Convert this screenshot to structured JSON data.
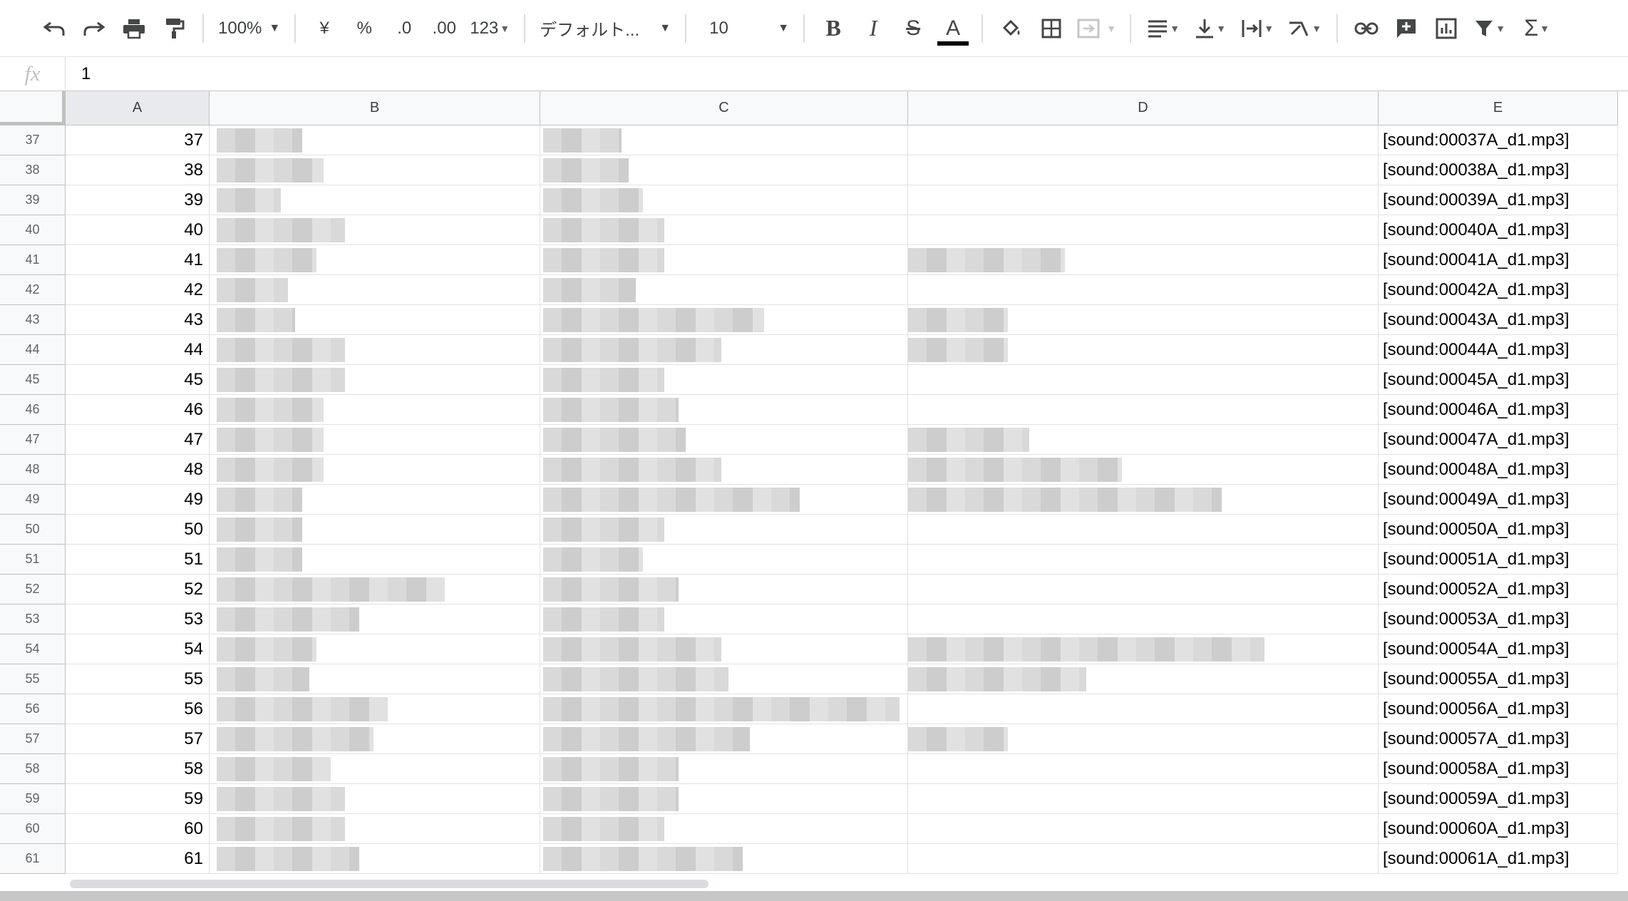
{
  "toolbar": {
    "zoom": "100%",
    "currency": "¥",
    "percent": "%",
    "decrease_decimal": ".0",
    "increase_decimal": ".00",
    "more_formats": "123",
    "font": "デフォルト...",
    "font_size": "10",
    "bold": "B",
    "italic": "I",
    "strike": "S",
    "text_color": "A"
  },
  "formula_bar": {
    "fx": "fx",
    "value": "1"
  },
  "columns": [
    {
      "letter": "A",
      "active": true
    },
    {
      "letter": "B",
      "active": false
    },
    {
      "letter": "C",
      "active": false
    },
    {
      "letter": "D",
      "active": false
    },
    {
      "letter": "E",
      "active": false
    }
  ],
  "rows": [
    {
      "row": "37",
      "a": "37",
      "e": "[sound:00037A_d1.mp3]"
    },
    {
      "row": "38",
      "a": "38",
      "e": "[sound:00038A_d1.mp3]"
    },
    {
      "row": "39",
      "a": "39",
      "e": "[sound:00039A_d1.mp3]"
    },
    {
      "row": "40",
      "a": "40",
      "e": "[sound:00040A_d1.mp3]"
    },
    {
      "row": "41",
      "a": "41",
      "e": "[sound:00041A_d1.mp3]"
    },
    {
      "row": "42",
      "a": "42",
      "e": "[sound:00042A_d1.mp3]"
    },
    {
      "row": "43",
      "a": "43",
      "e": "[sound:00043A_d1.mp3]"
    },
    {
      "row": "44",
      "a": "44",
      "e": "[sound:00044A_d1.mp3]"
    },
    {
      "row": "45",
      "a": "45",
      "e": "[sound:00045A_d1.mp3]"
    },
    {
      "row": "46",
      "a": "46",
      "e": "[sound:00046A_d1.mp3]"
    },
    {
      "row": "47",
      "a": "47",
      "e": "[sound:00047A_d1.mp3]"
    },
    {
      "row": "48",
      "a": "48",
      "e": "[sound:00048A_d1.mp3]"
    },
    {
      "row": "49",
      "a": "49",
      "e": "[sound:00049A_d1.mp3]"
    },
    {
      "row": "50",
      "a": "50",
      "e": "[sound:00050A_d1.mp3]"
    },
    {
      "row": "51",
      "a": "51",
      "e": "[sound:00051A_d1.mp3]"
    },
    {
      "row": "52",
      "a": "52",
      "e": "[sound:00052A_d1.mp3]"
    },
    {
      "row": "53",
      "a": "53",
      "e": "[sound:00053A_d1.mp3]"
    },
    {
      "row": "54",
      "a": "54",
      "e": "[sound:00054A_d1.mp3]"
    },
    {
      "row": "55",
      "a": "55",
      "e": "[sound:00055A_d1.mp3]"
    },
    {
      "row": "56",
      "a": "56",
      "e": "[sound:00056A_d1.mp3]"
    },
    {
      "row": "57",
      "a": "57",
      "e": "[sound:00057A_d1.mp3]"
    },
    {
      "row": "58",
      "a": "58",
      "e": "[sound:00058A_d1.mp3]"
    },
    {
      "row": "59",
      "a": "59",
      "e": "[sound:00059A_d1.mp3]"
    },
    {
      "row": "60",
      "a": "60",
      "e": "[sound:00060A_d1.mp3]"
    },
    {
      "row": "61",
      "a": "61",
      "e": "[sound:00061A_d1.mp3]"
    }
  ]
}
